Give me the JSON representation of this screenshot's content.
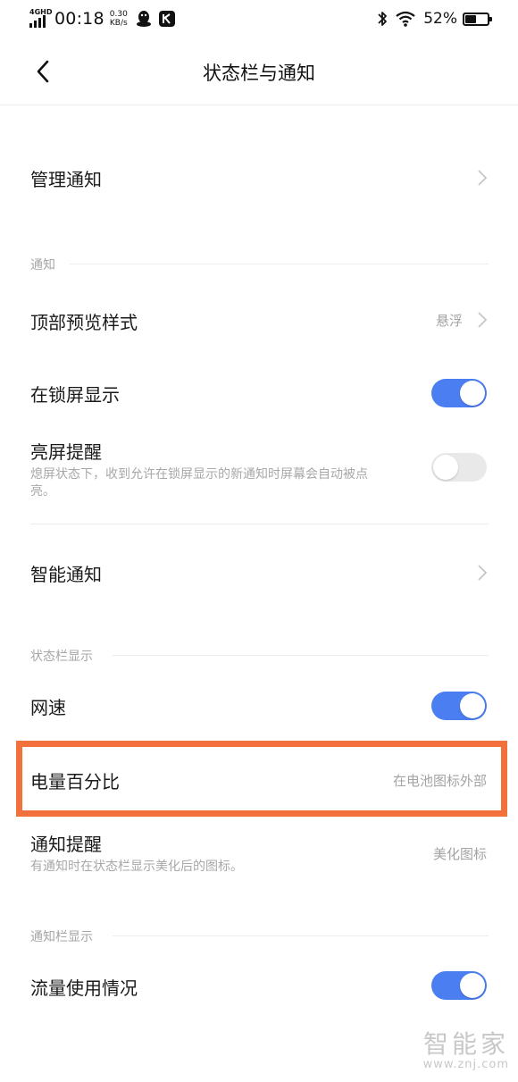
{
  "status_bar": {
    "network": "4GHD",
    "time": "00:18",
    "speed_value": "0.30",
    "speed_unit": "KB/s",
    "battery_percent": "52%",
    "battery_level": 0.52
  },
  "header": {
    "title": "状态栏与通知"
  },
  "items": {
    "manage_notifications": {
      "label": "管理通知"
    },
    "top_preview_style": {
      "label": "顶部预览样式",
      "value": "悬浮"
    },
    "show_on_lock_screen": {
      "label": "在锁屏显示",
      "enabled": true
    },
    "wake_screen_reminder": {
      "label": "亮屏提醒",
      "description_line1": "熄屏状态下，收到允许在锁屏显示的新通知时屏幕会自动被点",
      "description_line2": "亮。",
      "enabled": false
    },
    "smart_notification": {
      "label": "智能通知"
    },
    "network_speed": {
      "label": "网速",
      "enabled": true
    },
    "battery_percentage": {
      "label": "电量百分比",
      "value": "在电池图标外部"
    },
    "notification_reminder": {
      "label": "通知提醒",
      "description": "有通知时在状态栏显示美化后的图标。",
      "value": "美化图标"
    },
    "data_usage": {
      "label": "流量使用情况",
      "enabled": true
    }
  },
  "sections": {
    "notifications": "通知",
    "status_bar_display": "状态栏显示",
    "notification_bar_display": "通知栏显示"
  },
  "watermark": {
    "brand": "智能家",
    "url": "www.znj.com"
  },
  "colors": {
    "toggle_on": "#4a7ef1",
    "highlight": "#f2703c"
  }
}
